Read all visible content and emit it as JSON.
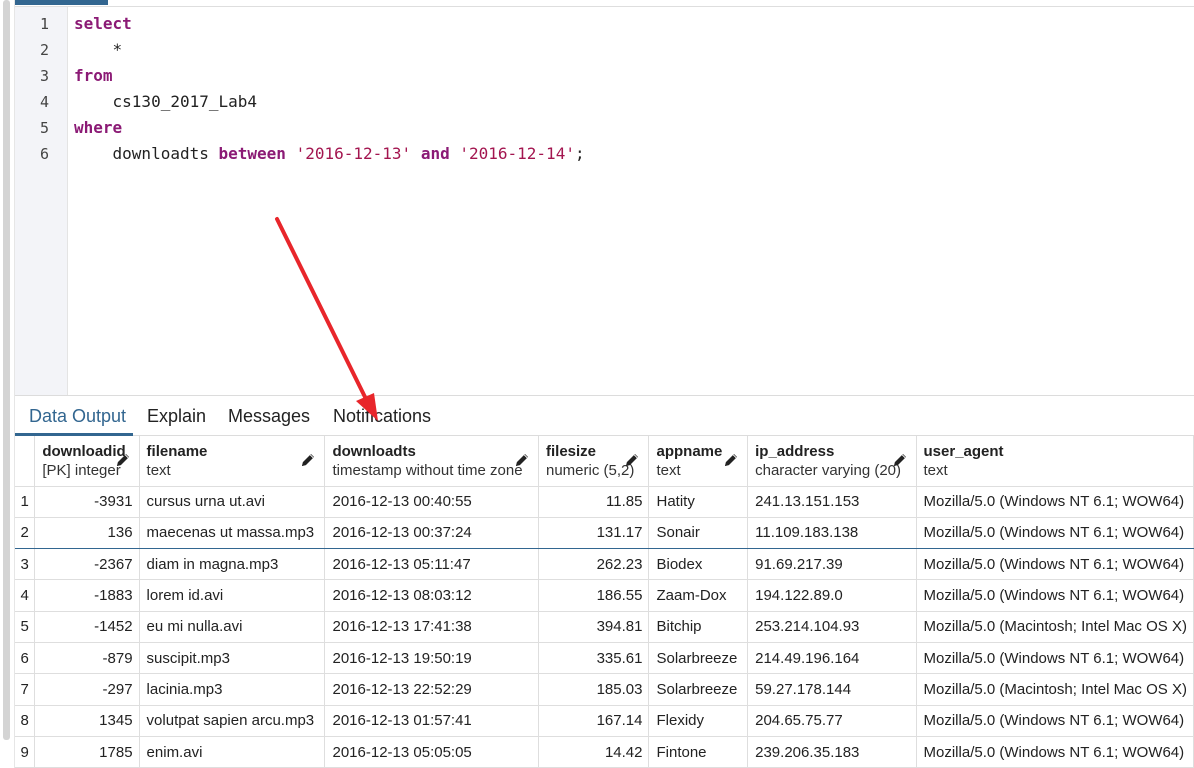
{
  "editor": {
    "lines": [
      {
        "num": "1",
        "tokens": [
          {
            "t": "select",
            "c": "kw"
          }
        ]
      },
      {
        "num": "2",
        "tokens": [
          {
            "t": "    *",
            "c": ""
          }
        ]
      },
      {
        "num": "3",
        "tokens": [
          {
            "t": "from",
            "c": "kw"
          }
        ]
      },
      {
        "num": "4",
        "tokens": [
          {
            "t": "    cs130_2017_Lab4",
            "c": ""
          }
        ]
      },
      {
        "num": "5",
        "tokens": [
          {
            "t": "where",
            "c": "kw"
          }
        ]
      },
      {
        "num": "6",
        "tokens": [
          {
            "t": "    downloadts ",
            "c": ""
          },
          {
            "t": "between",
            "c": "kw"
          },
          {
            "t": " ",
            "c": ""
          },
          {
            "t": "'2016-12-13'",
            "c": "str"
          },
          {
            "t": " ",
            "c": ""
          },
          {
            "t": "and",
            "c": "kw"
          },
          {
            "t": " ",
            "c": ""
          },
          {
            "t": "'2016-12-14'",
            "c": "str"
          },
          {
            "t": ";",
            "c": ""
          }
        ]
      }
    ]
  },
  "tabs": [
    "Data Output",
    "Explain",
    "Messages",
    "Notifications"
  ],
  "active_tab": "Data Output",
  "columns": [
    {
      "name": "downloadid",
      "type": "[PK] integer"
    },
    {
      "name": "filename",
      "type": "text"
    },
    {
      "name": "downloadts",
      "type": "timestamp without time zone"
    },
    {
      "name": "filesize",
      "type": "numeric (5,2)"
    },
    {
      "name": "appname",
      "type": "text"
    },
    {
      "name": "ip_address",
      "type": "character varying (20)"
    },
    {
      "name": "user_agent",
      "type": "text"
    }
  ],
  "rows": [
    [
      "1",
      "-3931",
      "cursus urna ut.avi",
      "2016-12-13 00:40:55",
      "11.85",
      "Hatity",
      "241.13.151.153",
      "Mozilla/5.0 (Windows NT 6.1; WOW64)"
    ],
    [
      "2",
      "136",
      "maecenas ut massa.mp3",
      "2016-12-13 00:37:24",
      "131.17",
      "Sonair",
      "11.109.183.138",
      "Mozilla/5.0 (Windows NT 6.1; WOW64)"
    ],
    [
      "3",
      "-2367",
      "diam in magna.mp3",
      "2016-12-13 05:11:47",
      "262.23",
      "Biodex",
      "91.69.217.39",
      "Mozilla/5.0 (Windows NT 6.1; WOW64)"
    ],
    [
      "4",
      "-1883",
      "lorem id.avi",
      "2016-12-13 08:03:12",
      "186.55",
      "Zaam-Dox",
      "194.122.89.0",
      "Mozilla/5.0 (Windows NT 6.1; WOW64)"
    ],
    [
      "5",
      "-1452",
      "eu mi nulla.avi",
      "2016-12-13 17:41:38",
      "394.81",
      "Bitchip",
      "253.214.104.93",
      "Mozilla/5.0 (Macintosh; Intel Mac OS X)"
    ],
    [
      "6",
      "-879",
      "suscipit.mp3",
      "2016-12-13 19:50:19",
      "335.61",
      "Solarbreeze",
      "214.49.196.164",
      "Mozilla/5.0 (Windows NT 6.1; WOW64)"
    ],
    [
      "7",
      "-297",
      "lacinia.mp3",
      "2016-12-13 22:52:29",
      "185.03",
      "Solarbreeze",
      "59.27.178.144",
      "Mozilla/5.0 (Macintosh; Intel Mac OS X)"
    ],
    [
      "8",
      "1345",
      "volutpat sapien arcu.mp3",
      "2016-12-13 01:57:41",
      "167.14",
      "Flexidy",
      "204.65.75.77",
      "Mozilla/5.0 (Windows NT 6.1; WOW64)"
    ],
    [
      "9",
      "1785",
      "enim.avi",
      "2016-12-13 05:05:05",
      "14.42",
      "Fintone",
      "239.206.35.183",
      "Mozilla/5.0 (Windows NT 6.1; WOW64)"
    ]
  ],
  "selected_row": 1,
  "colors": {
    "accent": "#326690",
    "keyword": "#8b1a75",
    "string": "#a3154f",
    "annotation_arrow": "#e8262b"
  }
}
